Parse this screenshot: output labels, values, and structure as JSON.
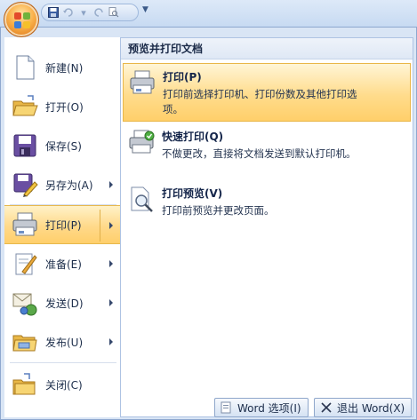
{
  "quick_access": {
    "icons": [
      "office-logo-icon",
      "save-icon",
      "undo-icon",
      "redo-icon",
      "print-preview-icon",
      "customize-dropdown-icon"
    ]
  },
  "menu": {
    "items": [
      {
        "label": "新建(N)",
        "icon": "new-document-icon",
        "has_submenu": false
      },
      {
        "label": "打开(O)",
        "icon": "open-folder-icon",
        "has_submenu": false
      },
      {
        "label": "保存(S)",
        "icon": "save-disk-icon",
        "has_submenu": false
      },
      {
        "label": "另存为(A)",
        "icon": "save-as-icon",
        "has_submenu": true
      },
      {
        "label": "打印(P)",
        "icon": "printer-icon",
        "has_submenu": true,
        "active": true
      },
      {
        "label": "准备(E)",
        "icon": "prepare-icon",
        "has_submenu": true
      },
      {
        "label": "发送(D)",
        "icon": "send-icon",
        "has_submenu": true
      },
      {
        "label": "发布(U)",
        "icon": "publish-icon",
        "has_submenu": true
      },
      {
        "label": "关闭(C)",
        "icon": "close-folder-icon",
        "has_submenu": false
      }
    ]
  },
  "submenu": {
    "header": "预览并打印文档",
    "items": [
      {
        "title": "打印(P)",
        "desc_line1": "打印前选择打印机、打印份数及其他打印选",
        "desc_line2": "项。",
        "icon": "printer-icon"
      },
      {
        "title": "快速打印(Q)",
        "desc_line1": "不做更改，直接将文档发送到默认打印机。",
        "desc_line2": "",
        "icon": "quick-print-icon"
      },
      {
        "title": "打印预览(V)",
        "desc_line1": "打印前预览并更改页面。",
        "desc_line2": "",
        "icon": "print-preview-icon"
      }
    ]
  },
  "footer": {
    "options_label": "Word 选项(I)",
    "exit_label": "退出 Word(X)"
  },
  "colors": {
    "highlight": "#ffd98a",
    "frame": "#d9e5f5",
    "office_button": "#f9b04a"
  }
}
